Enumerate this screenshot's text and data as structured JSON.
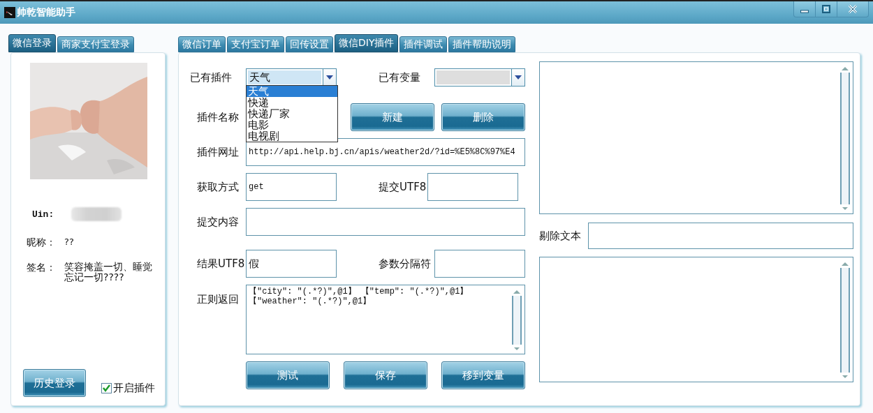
{
  "window": {
    "title": "帅乾智能助手"
  },
  "left_tabs": [
    {
      "label": "微信登录",
      "selected": true
    },
    {
      "label": "商家支付宝登录",
      "selected": false
    }
  ],
  "profile": {
    "uin_label": "Uin:",
    "nickname_label": "昵称：",
    "nickname": "??",
    "signature_label": "签名：",
    "signature": "笑容掩盖一切、睡觉忘记一切????",
    "history_button": "历史登录",
    "plugin_toggle": {
      "label": "开启插件",
      "checked": true
    }
  },
  "main_tabs": [
    {
      "label": "微信订单",
      "selected": false
    },
    {
      "label": "支付宝订单",
      "selected": false
    },
    {
      "label": "回传设置",
      "selected": false
    },
    {
      "label": "微信DIY插件",
      "selected": true
    },
    {
      "label": "插件调试",
      "selected": false
    },
    {
      "label": "插件帮助说明",
      "selected": false
    }
  ],
  "form": {
    "plugin_select": {
      "label": "已有插件",
      "value": "天气",
      "expanded": true,
      "options": [
        {
          "label": "天气",
          "selected": true
        },
        {
          "label": "快递",
          "selected": false
        },
        {
          "label": "快递厂家",
          "selected": false
        },
        {
          "label": "电影",
          "selected": false
        },
        {
          "label": "电视剧",
          "selected": false
        }
      ]
    },
    "variable_select": {
      "label": "已有变量",
      "disabled": true
    },
    "name_label": "插件名称",
    "new_button": "新建",
    "delete_button": "删除",
    "url": {
      "label": "插件网址",
      "value": "http://api.help.bj.cn/apis/weather2d/?id=%E5%8C%97%E4"
    },
    "method": {
      "label": "获取方式",
      "value": "get"
    },
    "submit_utf8": {
      "label": "提交UTF8"
    },
    "submit_content": {
      "label": "提交内容"
    },
    "result_utf8": {
      "label": "结果UTF8",
      "value": "假"
    },
    "separator": {
      "label": "参数分隔符"
    },
    "regex": {
      "label": "正则返回",
      "lines": [
        "【\"city\": \"(.*?)\",@1】 【\"temp\": \"(.*?)\",@1】",
        "【\"weather\": \"(.*?)\",@1】"
      ]
    },
    "buttons": [
      "测试",
      "保存",
      "移到变量"
    ]
  },
  "side": {
    "remove_text_label": "剔除文本"
  }
}
